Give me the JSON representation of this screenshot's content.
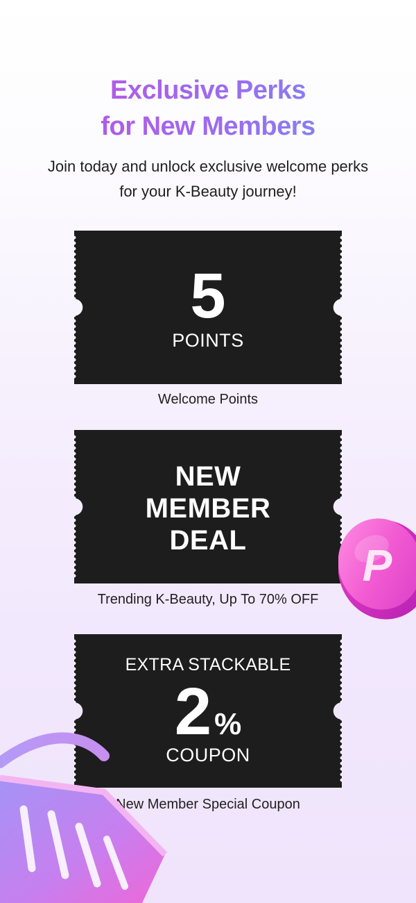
{
  "hero": {
    "title_line1": "Exclusive Perks",
    "title_line2": "for New Members",
    "subtitle_line1": "Join today and unlock exclusive welcome perks",
    "subtitle_line2": "for your K-Beauty journey!"
  },
  "perks": [
    {
      "value": "5",
      "label": "POINTS",
      "caption": "Welcome Points"
    },
    {
      "line1": "NEW",
      "line2": "MEMBER",
      "line3": "DEAL",
      "caption": "Trending K-Beauty, Up To 70% OFF"
    },
    {
      "top_label": "EXTRA STACKABLE",
      "value": "2",
      "unit": "%",
      "label": "COUPON",
      "caption": "New Member Special Coupon"
    }
  ],
  "decor": {
    "coin_letter": "P",
    "coin_icon": "points-coin-icon",
    "basket_icon": "shopping-basket-icon"
  },
  "colors": {
    "ticket": "#1d1d1d",
    "title_gradient_start": "#c04fe0",
    "title_gradient_end": "#6f95f4",
    "coin": "#f25bd2"
  }
}
